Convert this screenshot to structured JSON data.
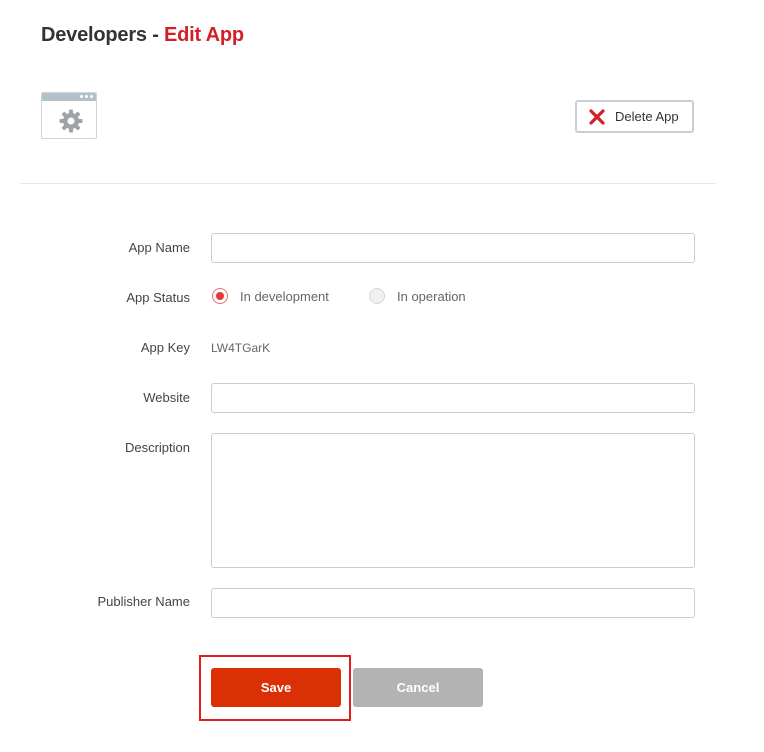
{
  "header": {
    "title_prefix": "Developers -",
    "title_accent": "Edit App"
  },
  "app_icon": {
    "icon": "app-window-gear-icon"
  },
  "delete_button": {
    "label": "Delete App",
    "icon": "close-x-icon"
  },
  "form": {
    "app_name": {
      "label": "App Name",
      "value": "",
      "placeholder": ""
    },
    "app_status": {
      "label": "App Status",
      "options": [
        {
          "label": "In development",
          "selected": true
        },
        {
          "label": "In operation",
          "selected": false
        }
      ]
    },
    "app_key": {
      "label": "App Key",
      "value": "LW4TGarK"
    },
    "website": {
      "label": "Website",
      "value": "",
      "placeholder": ""
    },
    "description": {
      "label": "Description",
      "value": "",
      "placeholder": ""
    },
    "publisher_name": {
      "label": "Publisher Name",
      "value": "",
      "placeholder": ""
    }
  },
  "actions": {
    "save_label": "Save",
    "cancel_label": "Cancel"
  },
  "colors": {
    "accent": "#d41f26",
    "save": "#db3006",
    "cancel": "#b3b3b3",
    "highlight": "#e31b1b"
  }
}
